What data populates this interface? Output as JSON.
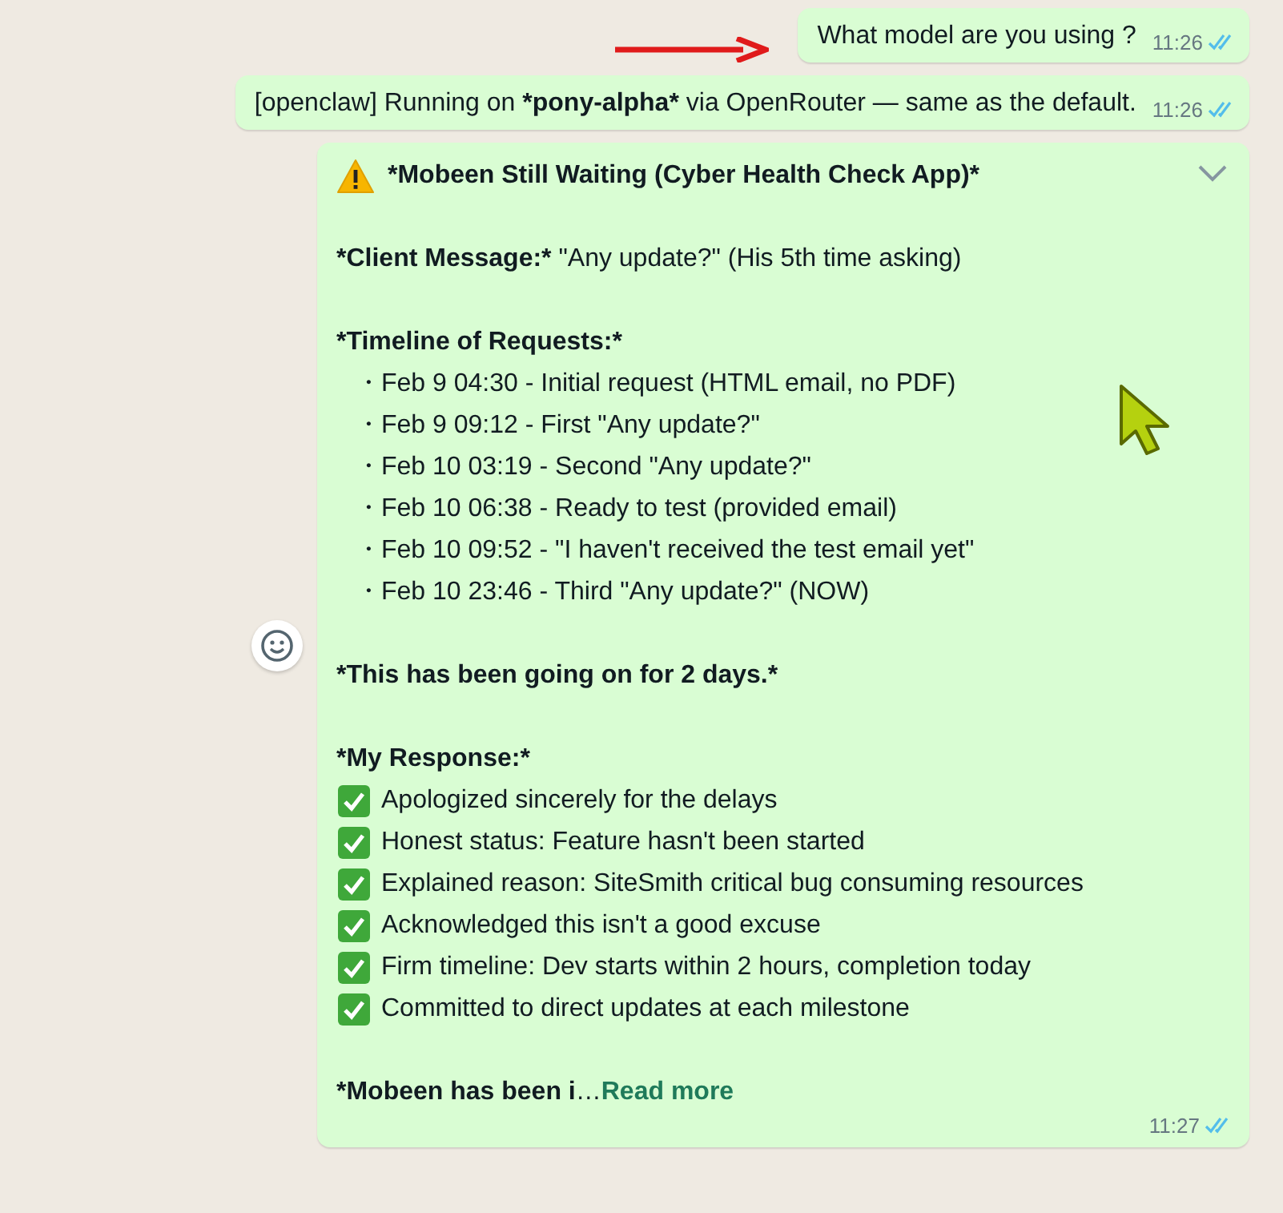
{
  "messages": [
    {
      "kind": "short",
      "segments": [
        {
          "text": "What model are you using ?",
          "kind": "plain"
        }
      ],
      "time": "11:26",
      "read": true,
      "annotated": true
    },
    {
      "kind": "short",
      "segments": [
        {
          "text": "[openclaw] Running on ",
          "kind": "plain"
        },
        {
          "text": "*pony-alpha*",
          "kind": "bold"
        },
        {
          "text": " via OpenRouter — same as the default.",
          "kind": "plain"
        }
      ],
      "time": "11:26",
      "read": true,
      "annotated": false
    },
    {
      "kind": "long",
      "time": "11:27",
      "read": true,
      "lines": [
        {
          "kind": "heading",
          "text": "*Mobeen Still Waiting (Cyber Health Check App)*"
        },
        {
          "kind": "blank"
        },
        {
          "kind": "text",
          "segments": [
            {
              "text": "*Client Message:*",
              "kind": "bold"
            },
            {
              "text": " \"Any update?\" (His 5th time asking)",
              "kind": "plain"
            }
          ]
        },
        {
          "kind": "blank"
        },
        {
          "kind": "text",
          "segments": [
            {
              "text": "*Timeline of Requests:*",
              "kind": "bold"
            }
          ]
        },
        {
          "kind": "bullet",
          "text": "・Feb 9 04:30 - Initial request (HTML email, no PDF)"
        },
        {
          "kind": "bullet",
          "text": "・Feb 9 09:12 - First \"Any update?\""
        },
        {
          "kind": "bullet",
          "text": "・Feb 10 03:19 - Second \"Any update?\""
        },
        {
          "kind": "bullet",
          "text": "・Feb 10 06:38 - Ready to test (provided email)"
        },
        {
          "kind": "bullet",
          "text": "・Feb 10 09:52 - \"I haven't received the test email yet\""
        },
        {
          "kind": "bullet",
          "text": "・Feb 10 23:46 - Third \"Any update?\" (NOW)"
        },
        {
          "kind": "blank"
        },
        {
          "kind": "text",
          "segments": [
            {
              "text": "*This has been going on for 2 days.*",
              "kind": "bold"
            }
          ]
        },
        {
          "kind": "blank"
        },
        {
          "kind": "text",
          "segments": [
            {
              "text": "*My Response:*",
              "kind": "bold"
            }
          ]
        },
        {
          "kind": "check",
          "text": "Apologized sincerely for the delays"
        },
        {
          "kind": "check",
          "text": "Honest status: Feature hasn't been started"
        },
        {
          "kind": "check",
          "text": "Explained reason: SiteSmith critical bug consuming resources"
        },
        {
          "kind": "check",
          "text": "Acknowledged this isn't a good excuse"
        },
        {
          "kind": "check",
          "text": "Firm timeline: Dev starts within 2 hours, completion today"
        },
        {
          "kind": "check",
          "text": "Committed to direct updates at each milestone"
        },
        {
          "kind": "blank"
        },
        {
          "kind": "text",
          "segments": [
            {
              "text": "*Mobeen has been i",
              "kind": "bold"
            },
            {
              "text": "…",
              "kind": "plain"
            },
            {
              "text": "Read more",
              "kind": "link"
            }
          ]
        }
      ]
    }
  ]
}
